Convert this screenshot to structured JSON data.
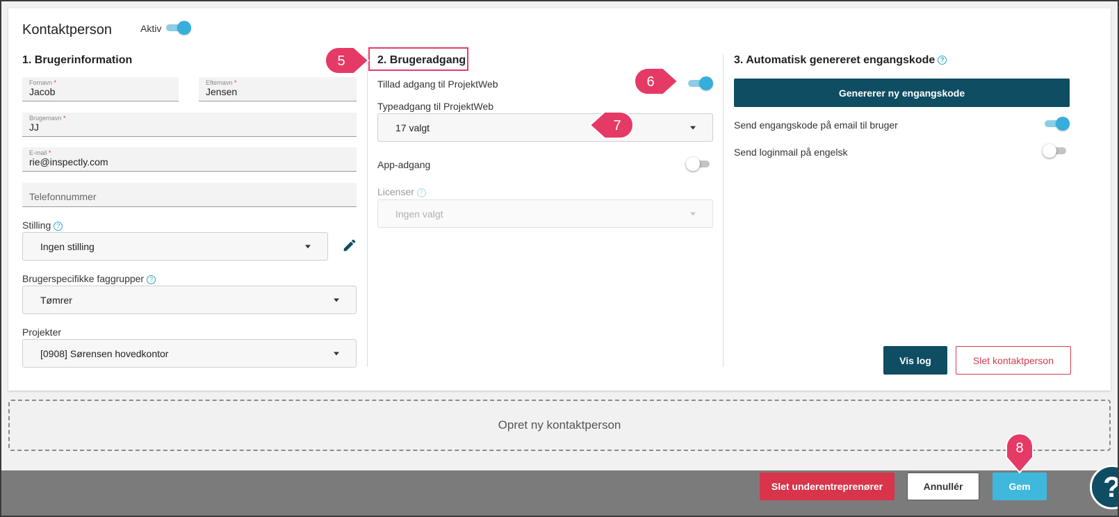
{
  "header": {
    "title": "Kontaktperson",
    "active_label": "Aktiv"
  },
  "section1": {
    "title": "1. Brugerinformation",
    "fornavn": {
      "label": "Fornavn",
      "value": "Jacob"
    },
    "efternavn": {
      "label": "Efternavn",
      "value": "Jensen"
    },
    "brugernavn": {
      "label": "Brugernavn",
      "value": "JJ"
    },
    "email": {
      "label": "E-mail",
      "value": "rie@inspectly.com"
    },
    "telefon": {
      "placeholder": "Telefonnummer"
    },
    "stilling": {
      "label": "Stilling",
      "value": "Ingen stilling"
    },
    "faggrupper": {
      "label": "Brugerspecifikke faggrupper",
      "value": "Tømrer"
    },
    "projekter": {
      "label": "Projekter",
      "value": "[0908] Sørensen hovedkontor"
    }
  },
  "section2": {
    "title": "2. Brugeradgang",
    "tillad_label": "Tillad adgang til ProjektWeb",
    "type_label": "Typeadgang til ProjektWeb",
    "type_value": "17 valgt",
    "app_label": "App-adgang",
    "licenser_label": "Licenser",
    "licenser_value": "Ingen valgt"
  },
  "section3": {
    "title": "3. Automatisk genereret engangskode",
    "generate_button": "Genererer ny engangskode",
    "send_email_label": "Send engangskode på email til bruger",
    "send_english_label": "Send loginmail på engelsk",
    "vis_log": "Vis log",
    "slet_kontakt": "Slet kontaktperson"
  },
  "new_contact": "Opret ny kontaktperson",
  "footer": {
    "delete_sub": "Slet underentreprenører",
    "cancel": "Annullér",
    "save": "Gem"
  },
  "help_fab": "?",
  "required_mark": "*",
  "callouts": {
    "c5": "5",
    "c6": "6",
    "c7": "7",
    "c8": "8"
  },
  "toggles": {
    "active": true,
    "tillad": true,
    "app": false,
    "send_email": true,
    "send_english": false
  },
  "colors": {
    "primary": "#0f4d63",
    "accent": "#36aedc",
    "danger": "#d8344a",
    "callout": "#e63a66"
  }
}
